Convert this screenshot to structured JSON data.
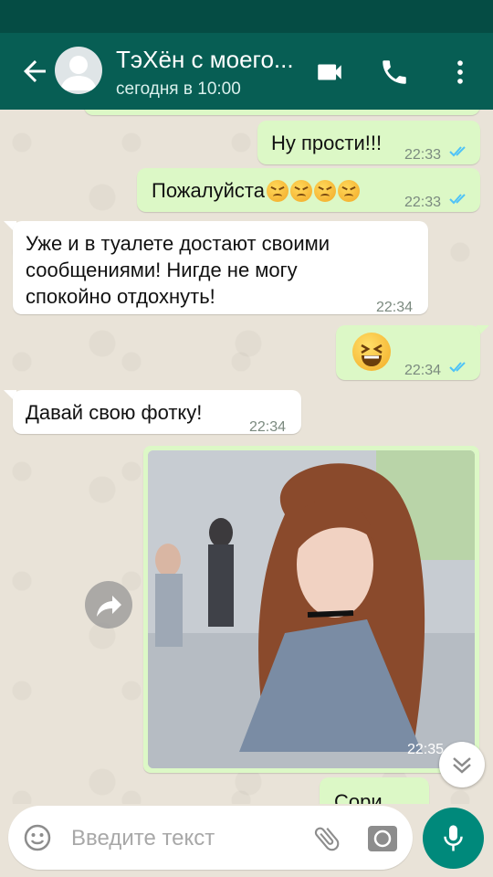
{
  "header": {
    "title": "ТэХён с моего...",
    "subtitle": "сегодня в 10:00"
  },
  "messages": [
    {
      "direction": "out",
      "text": "Ну прости!!!",
      "time": "22:33",
      "read": true
    },
    {
      "direction": "out",
      "text": "Пожалуйста",
      "emoji": "persevering-face x4",
      "time": "22:33",
      "read": true
    },
    {
      "direction": "in",
      "lines": [
        "Уже и в туалете достают своими",
        "сообщениями! Нигде не могу",
        "спокойно отдохнуть!"
      ],
      "time": "22:34"
    },
    {
      "direction": "out",
      "emoji": "laughing-face",
      "time": "22:34",
      "read": true
    },
    {
      "direction": "in",
      "text": "Давай свою фотку!",
      "time": "22:34"
    },
    {
      "direction": "out",
      "type": "photo",
      "time": "22:35"
    },
    {
      "direction": "out",
      "text": "Сори",
      "partial": true
    }
  ],
  "composer": {
    "placeholder": "Введите текст"
  },
  "colors": {
    "header_bg": "#075e54",
    "status_bg": "#054c44",
    "outgoing_bubble": "#dcf8c6",
    "incoming_bubble": "#ffffff",
    "read_ticks": "#4fc3f7",
    "mic_button": "#00897b"
  },
  "icons": [
    "back-arrow-icon",
    "avatar-icon",
    "video-call-icon",
    "phone-icon",
    "more-vert-icon",
    "double-check-icon",
    "forward-icon",
    "chevron-down-icon",
    "emoji-icon",
    "attach-icon",
    "camera-icon",
    "mic-icon"
  ]
}
